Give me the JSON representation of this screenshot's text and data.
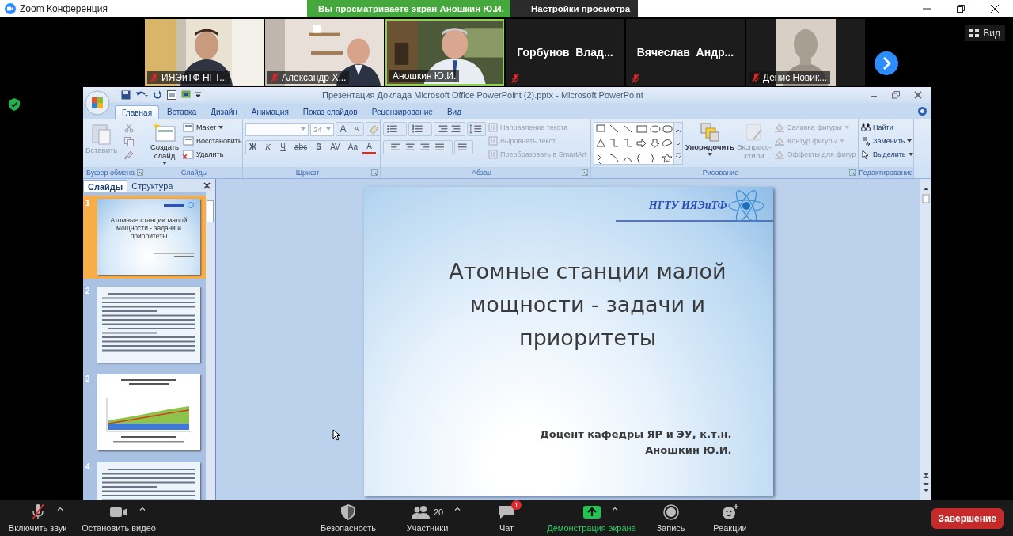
{
  "window": {
    "title": "Zoom Конференция"
  },
  "share_banner": {
    "text": "Вы просматриваете экран Аношкин Ю.И.",
    "menu": "Настройки просмотра"
  },
  "view_button": "Вид",
  "participants": [
    {
      "name": "ИЯЭиТФ НГТ...",
      "kind": "video",
      "muted": true,
      "speaking": false
    },
    {
      "name": "Александр Х...",
      "kind": "video",
      "muted": true,
      "speaking": false
    },
    {
      "name": "Аношкин Ю.И.",
      "kind": "video",
      "muted": false,
      "speaking": true
    },
    {
      "name": "Горбунов  Влад...",
      "kind": "name_only",
      "muted": true,
      "speaking": false
    },
    {
      "name": "Вячеслав  Андр...",
      "kind": "name_only",
      "muted": true,
      "speaking": false
    },
    {
      "name": "Денис Новик...",
      "muted": true,
      "speaking": false
    }
  ],
  "powerpoint": {
    "title": "Презентация Доклада Microsoft Office PowerPoint (2).pptx - Microsoft PowerPoint",
    "tabs": [
      {
        "label": "Главная",
        "selected": true
      },
      {
        "label": "Вставка",
        "selected": false
      },
      {
        "label": "Дизайн",
        "selected": false
      },
      {
        "label": "Анимация",
        "selected": false
      },
      {
        "label": "Показ слайдов",
        "selected": false
      },
      {
        "label": "Рецензирование",
        "selected": false
      },
      {
        "label": "Вид",
        "selected": false
      }
    ],
    "groups": [
      {
        "kind": "clipboard",
        "label": "Буфер обмена",
        "paste": {
          "label": "Вставить",
          "disabled": true
        }
      },
      {
        "kind": "slides",
        "label": "Слайды",
        "new_slide": "Создать слайд",
        "commands": [
          {
            "label": "Макет",
            "dropdown": true
          },
          {
            "label": "Восстановить",
            "dropdown": false
          },
          {
            "label": "Удалить",
            "dropdown": false
          }
        ]
      },
      {
        "kind": "font",
        "label": "Шрифт",
        "font_size": "24",
        "size_buttons": [
          "A",
          "A"
        ],
        "styles": [
          {
            "label": "Ж",
            "kind": "bold"
          },
          {
            "label": "К",
            "kind": "italic"
          },
          {
            "label": "Ч",
            "kind": "underline"
          },
          {
            "label": "abc",
            "kind": "strike"
          },
          {
            "label": "S",
            "kind": "shadow"
          },
          {
            "label": "AV",
            "kind": "spacing"
          },
          {
            "label": "Аа",
            "kind": "case"
          },
          {
            "label": "A",
            "kind": "color"
          }
        ]
      },
      {
        "kind": "paragraph",
        "label": "Абзац",
        "commands": [
          {
            "label": "Направление текста",
            "disabled": true
          },
          {
            "label": "Выровнять текст",
            "disabled": true
          },
          {
            "label": "Преобразовать в SmartArt",
            "disabled": true
          }
        ]
      },
      {
        "kind": "drawing",
        "label": "Рисование",
        "arrange": "Упорядочить",
        "quick_styles": {
          "label": "Экспресс-стили",
          "disabled": true
        },
        "commands": [
          {
            "label": "Заливка фигуры",
            "disabled": true
          },
          {
            "label": "Контур фигуры",
            "disabled": true
          },
          {
            "label": "Эффекты для фигур",
            "disabled": true
          }
        ]
      },
      {
        "kind": "editing",
        "label": "Редактирование",
        "commands": [
          {
            "label": "Найти",
            "dropdown": false
          },
          {
            "label": "Заменить",
            "dropdown": true
          },
          {
            "label": "Выделить",
            "dropdown": true
          }
        ]
      }
    ],
    "panel_tabs": [
      {
        "label": "Слайды",
        "selected": true
      },
      {
        "label": "Структура",
        "selected": false
      }
    ],
    "slides": [
      {
        "number": "1",
        "kind": "title",
        "selected": true,
        "title": "Атомные станции малой мощности - задачи и приоритеты"
      },
      {
        "number": "2",
        "kind": "text",
        "selected": false
      },
      {
        "number": "3",
        "kind": "chart",
        "selected": false
      },
      {
        "number": "4",
        "kind": "text",
        "selected": false
      }
    ],
    "current_slide": {
      "logo": "НГТУ ИЯЭиТФ",
      "title": "Атомные станции малой мощности - задачи и приоритеты",
      "subtitle": [
        "Доцент кафедры ЯР и ЭУ, к.т.н.",
        "Аношкин Ю.И."
      ]
    }
  },
  "toolbar": [
    {
      "label": "Включить звук",
      "kind": "audio",
      "caret": true
    },
    {
      "label": "Остановить видео",
      "kind": "video",
      "caret": true
    },
    {
      "label": "Безопасность",
      "kind": "security",
      "caret": false
    },
    {
      "label": "Участники",
      "kind": "participants",
      "count": "20",
      "caret": true
    },
    {
      "label": "Чат",
      "kind": "chat",
      "badge": "1",
      "caret": false
    },
    {
      "label": "Демонстрация экрана",
      "kind": "share",
      "caret": true
    },
    {
      "label": "Запись",
      "kind": "record",
      "caret": false
    },
    {
      "label": "Реакции",
      "kind": "reactions",
      "caret": false
    }
  ],
  "end_button": "Завершение"
}
